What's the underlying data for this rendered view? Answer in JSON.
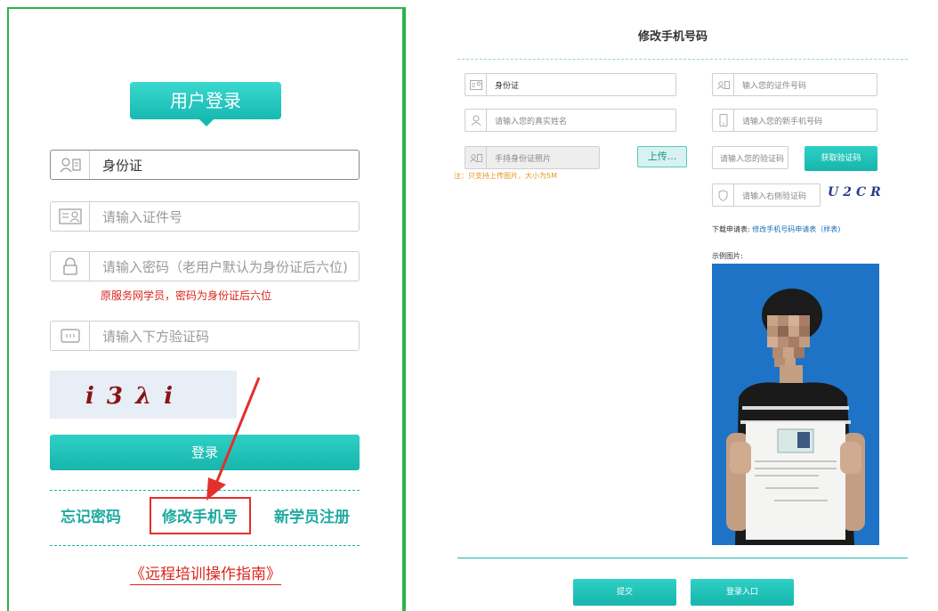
{
  "login": {
    "title": "用户登录",
    "id_type": "身份证",
    "id_placeholder": "请输入证件号",
    "password_placeholder": "请输入密码（老用户默认为身份证后六位)",
    "password_note": "原服务网学员，密码为身份证后六位",
    "captcha_placeholder": "请输入下方验证码",
    "captcha_text": "i3λi",
    "login_button": "登录",
    "forgot_password": "忘记密码",
    "change_phone": "修改手机号",
    "register": "新学员注册",
    "guide": "《远程培训操作指南》"
  },
  "change_phone_form": {
    "title": "修改手机号码",
    "id_type": "身份证",
    "name_placeholder": "请输入您的真实姓名",
    "photo_placeholder": "手持身份证照片",
    "upload_button": "上传...",
    "upload_note": "注：只支持上传图片，大小为5M",
    "id_number_placeholder": "输入您的证件号码",
    "new_phone_placeholder": "请输入您的新手机号码",
    "code_placeholder": "请输入您的验证码",
    "get_code_button": "获取验证码",
    "captcha_placeholder": "请输入右侧验证码",
    "captcha_text": "U2CR",
    "download_prefix": "下载申请表:",
    "download_link": "修改手机号码申请表（样表)",
    "example_label": "示例图片:",
    "submit_button": "提交",
    "login_entry_button": "登录入口"
  },
  "colors": {
    "accent": "#1fbdb3",
    "border_green": "#2bb34b",
    "alert_red": "#d9261c",
    "note_orange": "#e7931d"
  }
}
